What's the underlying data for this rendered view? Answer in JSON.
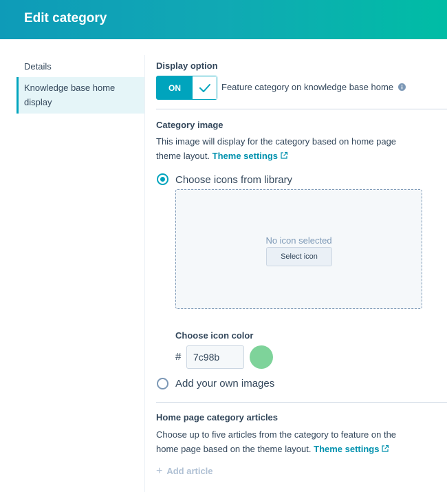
{
  "header": {
    "title": "Edit category"
  },
  "sidebar": {
    "items": [
      {
        "label": "Details"
      },
      {
        "label": "Knowledge base home display"
      }
    ]
  },
  "display_option": {
    "heading": "Display option",
    "toggle_label": "ON",
    "toggle_state": true,
    "feature_label": "Feature category on knowledge base home"
  },
  "category_image": {
    "heading": "Category image",
    "description": "This image will display for the category based on home page theme layout.",
    "theme_link": "Theme settings",
    "option_library": "Choose icons from library",
    "option_library_selected": true,
    "no_icon_text": "No icon selected",
    "select_button": "Select icon",
    "color_heading": "Choose icon color",
    "hash": "#",
    "color_value": "7c98b",
    "swatch_color": "#7ed39a",
    "option_own": "Add your own images",
    "option_own_selected": false
  },
  "articles": {
    "heading": "Home page category articles",
    "description": "Choose up to five articles from the category to feature on the home page based on the theme layout.",
    "theme_link": "Theme settings",
    "add_article": "Add article"
  },
  "colors": {
    "accent": "#00a4bd",
    "link": "#0091ae",
    "text": "#33475b",
    "muted": "#7c98b6",
    "active_bg": "#e5f5f8"
  }
}
